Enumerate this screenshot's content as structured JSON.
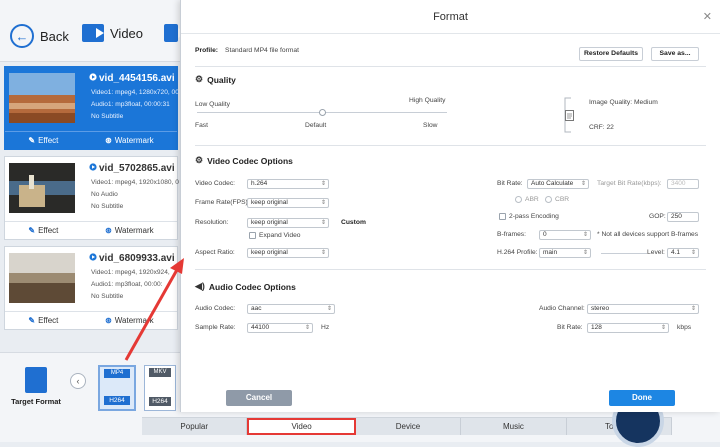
{
  "toolbar": {
    "back_label": "Back",
    "video_label": "Video"
  },
  "files": [
    {
      "name": "vid_4454156.avi",
      "video": "Video1: mpeg4, 1280x720, 00:",
      "audio": "Audio1: mp3float, 00:00:31",
      "subtitle": "No Subtitle",
      "effect": "Effect",
      "watermark": "Watermark"
    },
    {
      "name": "vid_5702865.avi",
      "video": "Video1: mpeg4, 1920x1080, 0",
      "audio": "No Audio",
      "subtitle": "No Subtitle",
      "effect": "Effect",
      "watermark": "Watermark"
    },
    {
      "name": "vid_6809933.avi",
      "video": "Video1: mpeg4, 1920x924,",
      "audio": "Audio1: mp3float, 00:00:",
      "subtitle": "No Subtitle",
      "effect": "Effect",
      "watermark": "Watermark"
    }
  ],
  "target_format_label": "Target Format",
  "formats": [
    {
      "tag": "MP4",
      "codec": "H264"
    },
    {
      "tag": "MKV",
      "codec": "H264"
    }
  ],
  "tabs": [
    "Popular",
    "Video",
    "Device",
    "Music",
    "Toolbox"
  ],
  "dialog": {
    "title": "Format",
    "profile_label": "Profile:",
    "profile_value": "Standard MP4 file format",
    "restore_defaults": "Restore Defaults",
    "save_as": "Save as...",
    "cancel": "Cancel",
    "done": "Done",
    "quality": {
      "section": "Quality",
      "low": "Low Quality",
      "high": "High Quality",
      "fast": "Fast",
      "default": "Default",
      "slow": "Slow",
      "image_quality": "Image Quality: Medium",
      "crf": "CRF: 22",
      "slider_level": 0.5
    },
    "video": {
      "section": "Video Codec Options",
      "codec_label": "Video Codec:",
      "codec_value": "h.264",
      "framerate_label": "Frame Rate(FPS):",
      "framerate_value": "keep original",
      "resolution_label": "Resolution:",
      "resolution_value": "keep original",
      "custom": "Custom",
      "expand_video": "Expand Video",
      "aspect_label": "Aspect Ratio:",
      "aspect_value": "keep original",
      "bitrate_label": "Bit Rate:",
      "bitrate_value": "Auto Calculate",
      "target_bitrate_label": "Target Bit Rate(kbps):",
      "target_bitrate_value": "3400",
      "abr": "ABR",
      "cbr": "CBR",
      "twopass": "2-pass Encoding",
      "gop_label": "GOP:",
      "gop_value": "250",
      "bframes_label": "B-frames:",
      "bframes_value": "0",
      "bframes_note": "* Not all devices support B-frames",
      "profile_label": "H.264 Profile:",
      "profile_value": "main",
      "level_label": "Level:",
      "level_value": "4.1"
    },
    "audio": {
      "section": "Audio Codec Options",
      "codec_label": "Audio Codec:",
      "codec_value": "aac",
      "samplerate_label": "Sample Rate:",
      "samplerate_value": "44100",
      "hz": "Hz",
      "channel_label": "Audio Channel:",
      "channel_value": "stereo",
      "bitrate_label": "Bit Rate:",
      "bitrate_value": "128",
      "kbps": "kbps"
    }
  },
  "colors": {
    "accent": "#1d86e3",
    "highlight": "#e53935"
  }
}
